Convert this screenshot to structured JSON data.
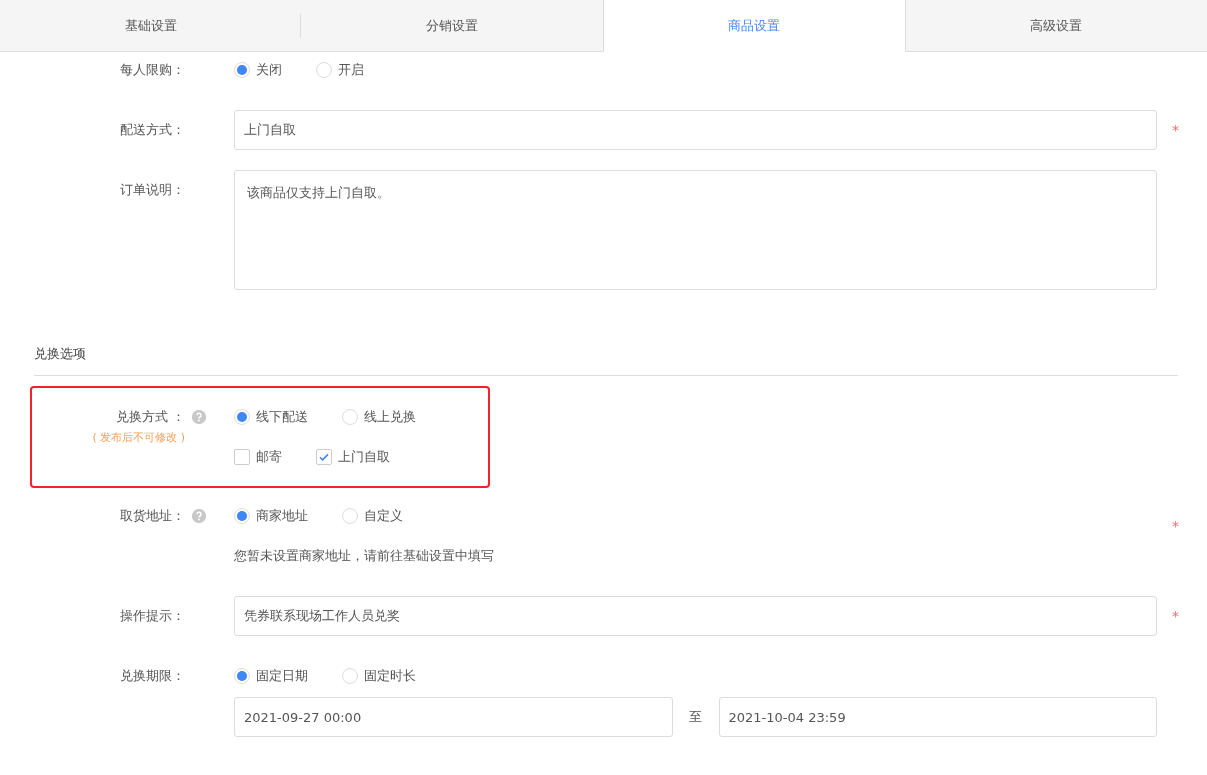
{
  "tabs": [
    {
      "label": "基础设置",
      "selected": false
    },
    {
      "label": "分销设置",
      "selected": false
    },
    {
      "label": "商品设置",
      "selected": true
    },
    {
      "label": "高级设置",
      "selected": false
    }
  ],
  "rows": [
    {
      "kind": "radio",
      "label": "每人限购：",
      "options": [
        {
          "label": "关闭",
          "selected": true
        },
        {
          "label": "开启",
          "selected": false
        }
      ]
    },
    {
      "kind": "input",
      "label": "配送方式：",
      "value": "上门自取",
      "required_mark": "*"
    },
    {
      "kind": "textarea",
      "label": "订单说明：",
      "value": "该商品仅支持上门自取。"
    },
    {
      "kind": "section",
      "title": "兑换选项"
    },
    {
      "kind": "radio",
      "label": "兑换方式 ：",
      "note": "( 发布后不可修改 )",
      "help": true,
      "highlighted": true,
      "options": [
        {
          "label": "线下配送",
          "selected": true
        },
        {
          "label": "线上兑换",
          "selected": false
        }
      ],
      "checkboxes": [
        {
          "label": "邮寄",
          "checked": false
        },
        {
          "label": "上门自取",
          "checked": true
        }
      ]
    },
    {
      "kind": "radio",
      "label": "取货地址：",
      "help": true,
      "required_mark": "*",
      "options": [
        {
          "label": "商家地址",
          "selected": true
        },
        {
          "label": "自定义",
          "selected": false
        }
      ],
      "hint": "您暂未设置商家地址，请前往基础设置中填写"
    },
    {
      "kind": "input",
      "label": "操作提示：",
      "value": "凭券联系现场工作人员兑奖",
      "required_mark": "*"
    },
    {
      "kind": "radio",
      "label": "兑换期限：",
      "options": [
        {
          "label": "固定日期",
          "selected": true
        },
        {
          "label": "固定时长",
          "selected": false
        }
      ],
      "range": {
        "start": "2021-09-27 00:00",
        "separator": "至",
        "end": "2021-10-04 23:59"
      }
    }
  ]
}
